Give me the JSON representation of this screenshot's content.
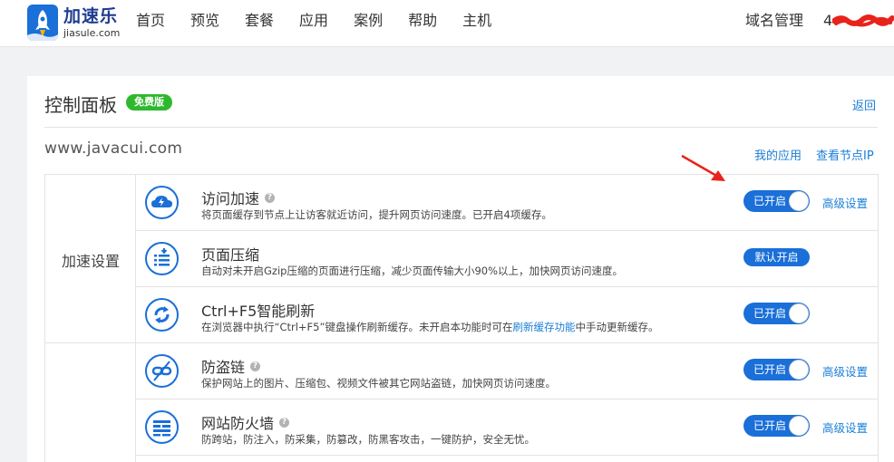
{
  "brand": {
    "name_cn": "加速乐",
    "domain": "jiasule.com"
  },
  "nav": [
    "首页",
    "预览",
    "套餐",
    "应用",
    "案例",
    "帮助",
    "主机"
  ],
  "header_right": {
    "domain_manage": "域名管理",
    "account_prefix": "4"
  },
  "panel": {
    "title": "控制面板",
    "badge": "免费版",
    "back": "返回",
    "site": "www.javacui.com",
    "my_apps": "我的应用",
    "view_nodes": "查看节点IP"
  },
  "groups": [
    {
      "label": "加速设置"
    }
  ],
  "rows": [
    {
      "icon": "cloud-lightning-icon",
      "title": "访问加速",
      "help": "?",
      "desc": "将页面缓存到节点上让访客就近访问，提升网页访问速度。已开启4项缓存。",
      "state": "已开启",
      "advanced": "高级设置"
    },
    {
      "icon": "compress-list-icon",
      "title": "页面压缩",
      "desc": "自动对未开启Gzip压缩的页面进行压缩，减少页面传输大小90%以上，加快网页访问速度。",
      "state": "默认开启"
    },
    {
      "icon": "refresh-arrows-icon",
      "title": "Ctrl+F5智能刷新",
      "desc_before": "在浏览器中执行“Ctrl+F5”键盘操作刷新缓存。未开启本功能时可在",
      "desc_link": "刷新缓存功能",
      "desc_after": "中手动更新缓存。",
      "state": "已开启"
    },
    {
      "icon": "broken-link-icon",
      "title": "防盗链",
      "help": "?",
      "desc": "保护网站上的图片、压缩包、视频文件被其它网站盗链，加快网页访问速度。",
      "state": "已开启",
      "advanced": "高级设置"
    },
    {
      "icon": "firewall-icon",
      "title": "网站防火墙",
      "help": "?",
      "desc": "防跨站，防注入，防采集，防篡改，防黑客攻击，一键防护，安全无忧。",
      "state": "已开启",
      "advanced": "高级设置"
    }
  ],
  "colors": {
    "accent": "#1a6fd8",
    "link": "#1a7ed6",
    "badge": "#2eb82e",
    "annotation": "#e8231b"
  }
}
